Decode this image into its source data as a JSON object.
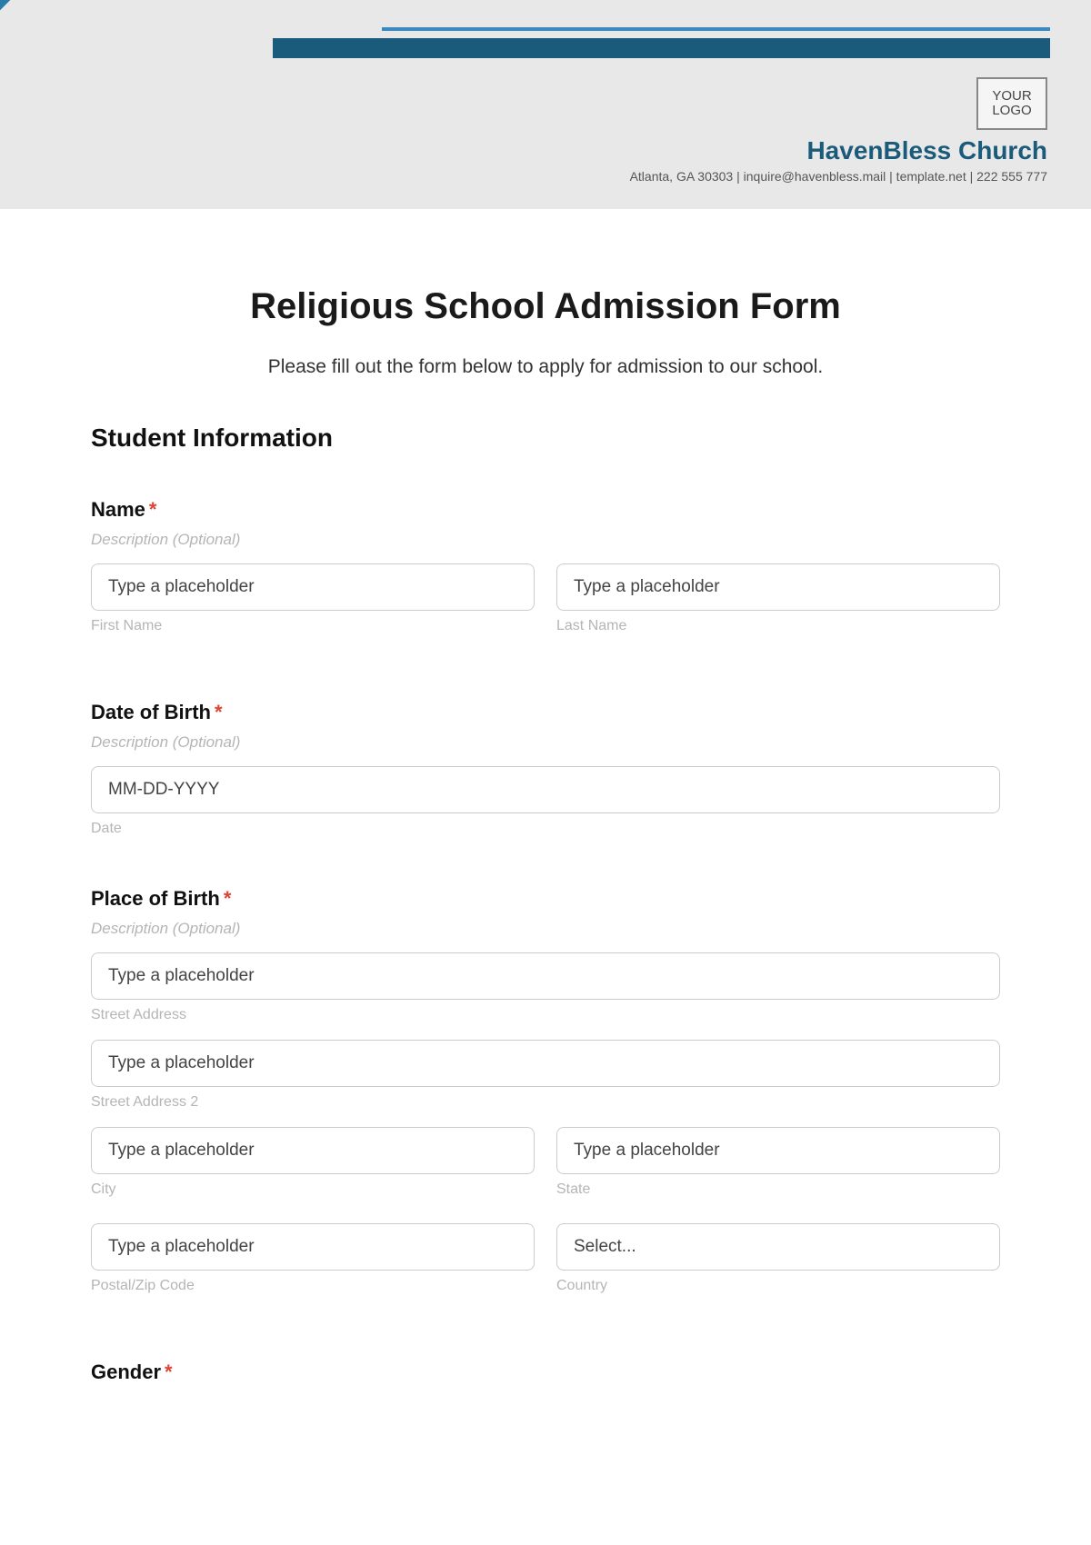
{
  "header": {
    "logo_text": "YOUR LOGO",
    "org_name": "HavenBless Church",
    "contact": "Atlanta, GA 30303 | inquire@havenbless.mail | template.net | 222 555 777"
  },
  "form": {
    "title": "Religious School Admission Form",
    "subtitle": "Please fill out the form below to apply for admission to our school.",
    "section1_title": "Student Information",
    "desc_optional": "Description (Optional)",
    "placeholder_generic": "Type a placeholder",
    "name": {
      "label": "Name",
      "first_sublabel": "First Name",
      "last_sublabel": "Last Name"
    },
    "dob": {
      "label": "Date of Birth",
      "placeholder": "MM-DD-YYYY",
      "sublabel": "Date"
    },
    "pob": {
      "label": "Place of Birth",
      "street1_sublabel": "Street Address",
      "street2_sublabel": "Street Address 2",
      "city_sublabel": "City",
      "state_sublabel": "State",
      "postal_sublabel": "Postal/Zip Code",
      "country_sublabel": "Country",
      "country_placeholder": "Select..."
    },
    "gender": {
      "label": "Gender"
    }
  }
}
